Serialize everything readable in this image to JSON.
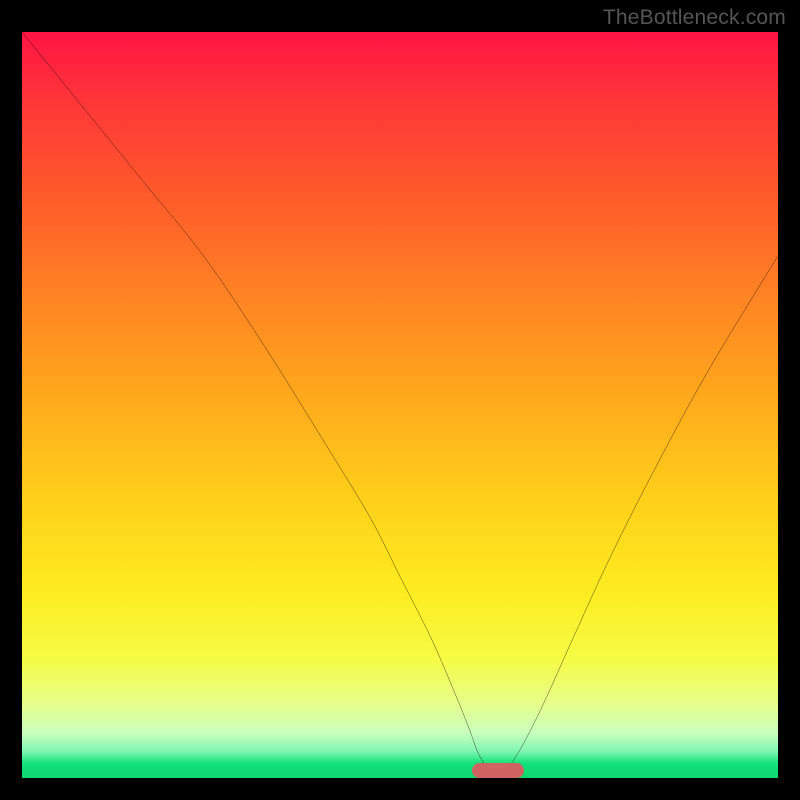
{
  "watermark": "TheBottleneck.com",
  "chart_data": {
    "type": "line",
    "title": "",
    "xlabel": "",
    "ylabel": "",
    "xlim": [
      0,
      100
    ],
    "ylim": [
      0,
      100
    ],
    "background_gradient": {
      "top": "#ff1444",
      "mid": "#ffce1a",
      "bottom": "#0bd86f"
    },
    "series": [
      {
        "name": "bottleneck-curve",
        "x": [
          0,
          8,
          16,
          24,
          32,
          40,
          46,
          50,
          54,
          57,
          59,
          60.5,
          62,
          63,
          64,
          66,
          69,
          73,
          78,
          84,
          91,
          100
        ],
        "values": [
          100,
          90,
          80,
          70,
          58,
          45,
          35,
          27,
          19,
          12,
          7,
          3,
          1,
          0.2,
          1,
          4,
          10,
          19,
          30,
          42,
          55,
          70
        ]
      }
    ],
    "marker": {
      "name": "optimum-marker",
      "x_center": 63,
      "width_pct": 6.9,
      "color": "#d06262"
    },
    "grid": false,
    "legend": false
  },
  "colors": {
    "frame": "#000000",
    "watermark": "#555555",
    "curve": "#000000"
  }
}
